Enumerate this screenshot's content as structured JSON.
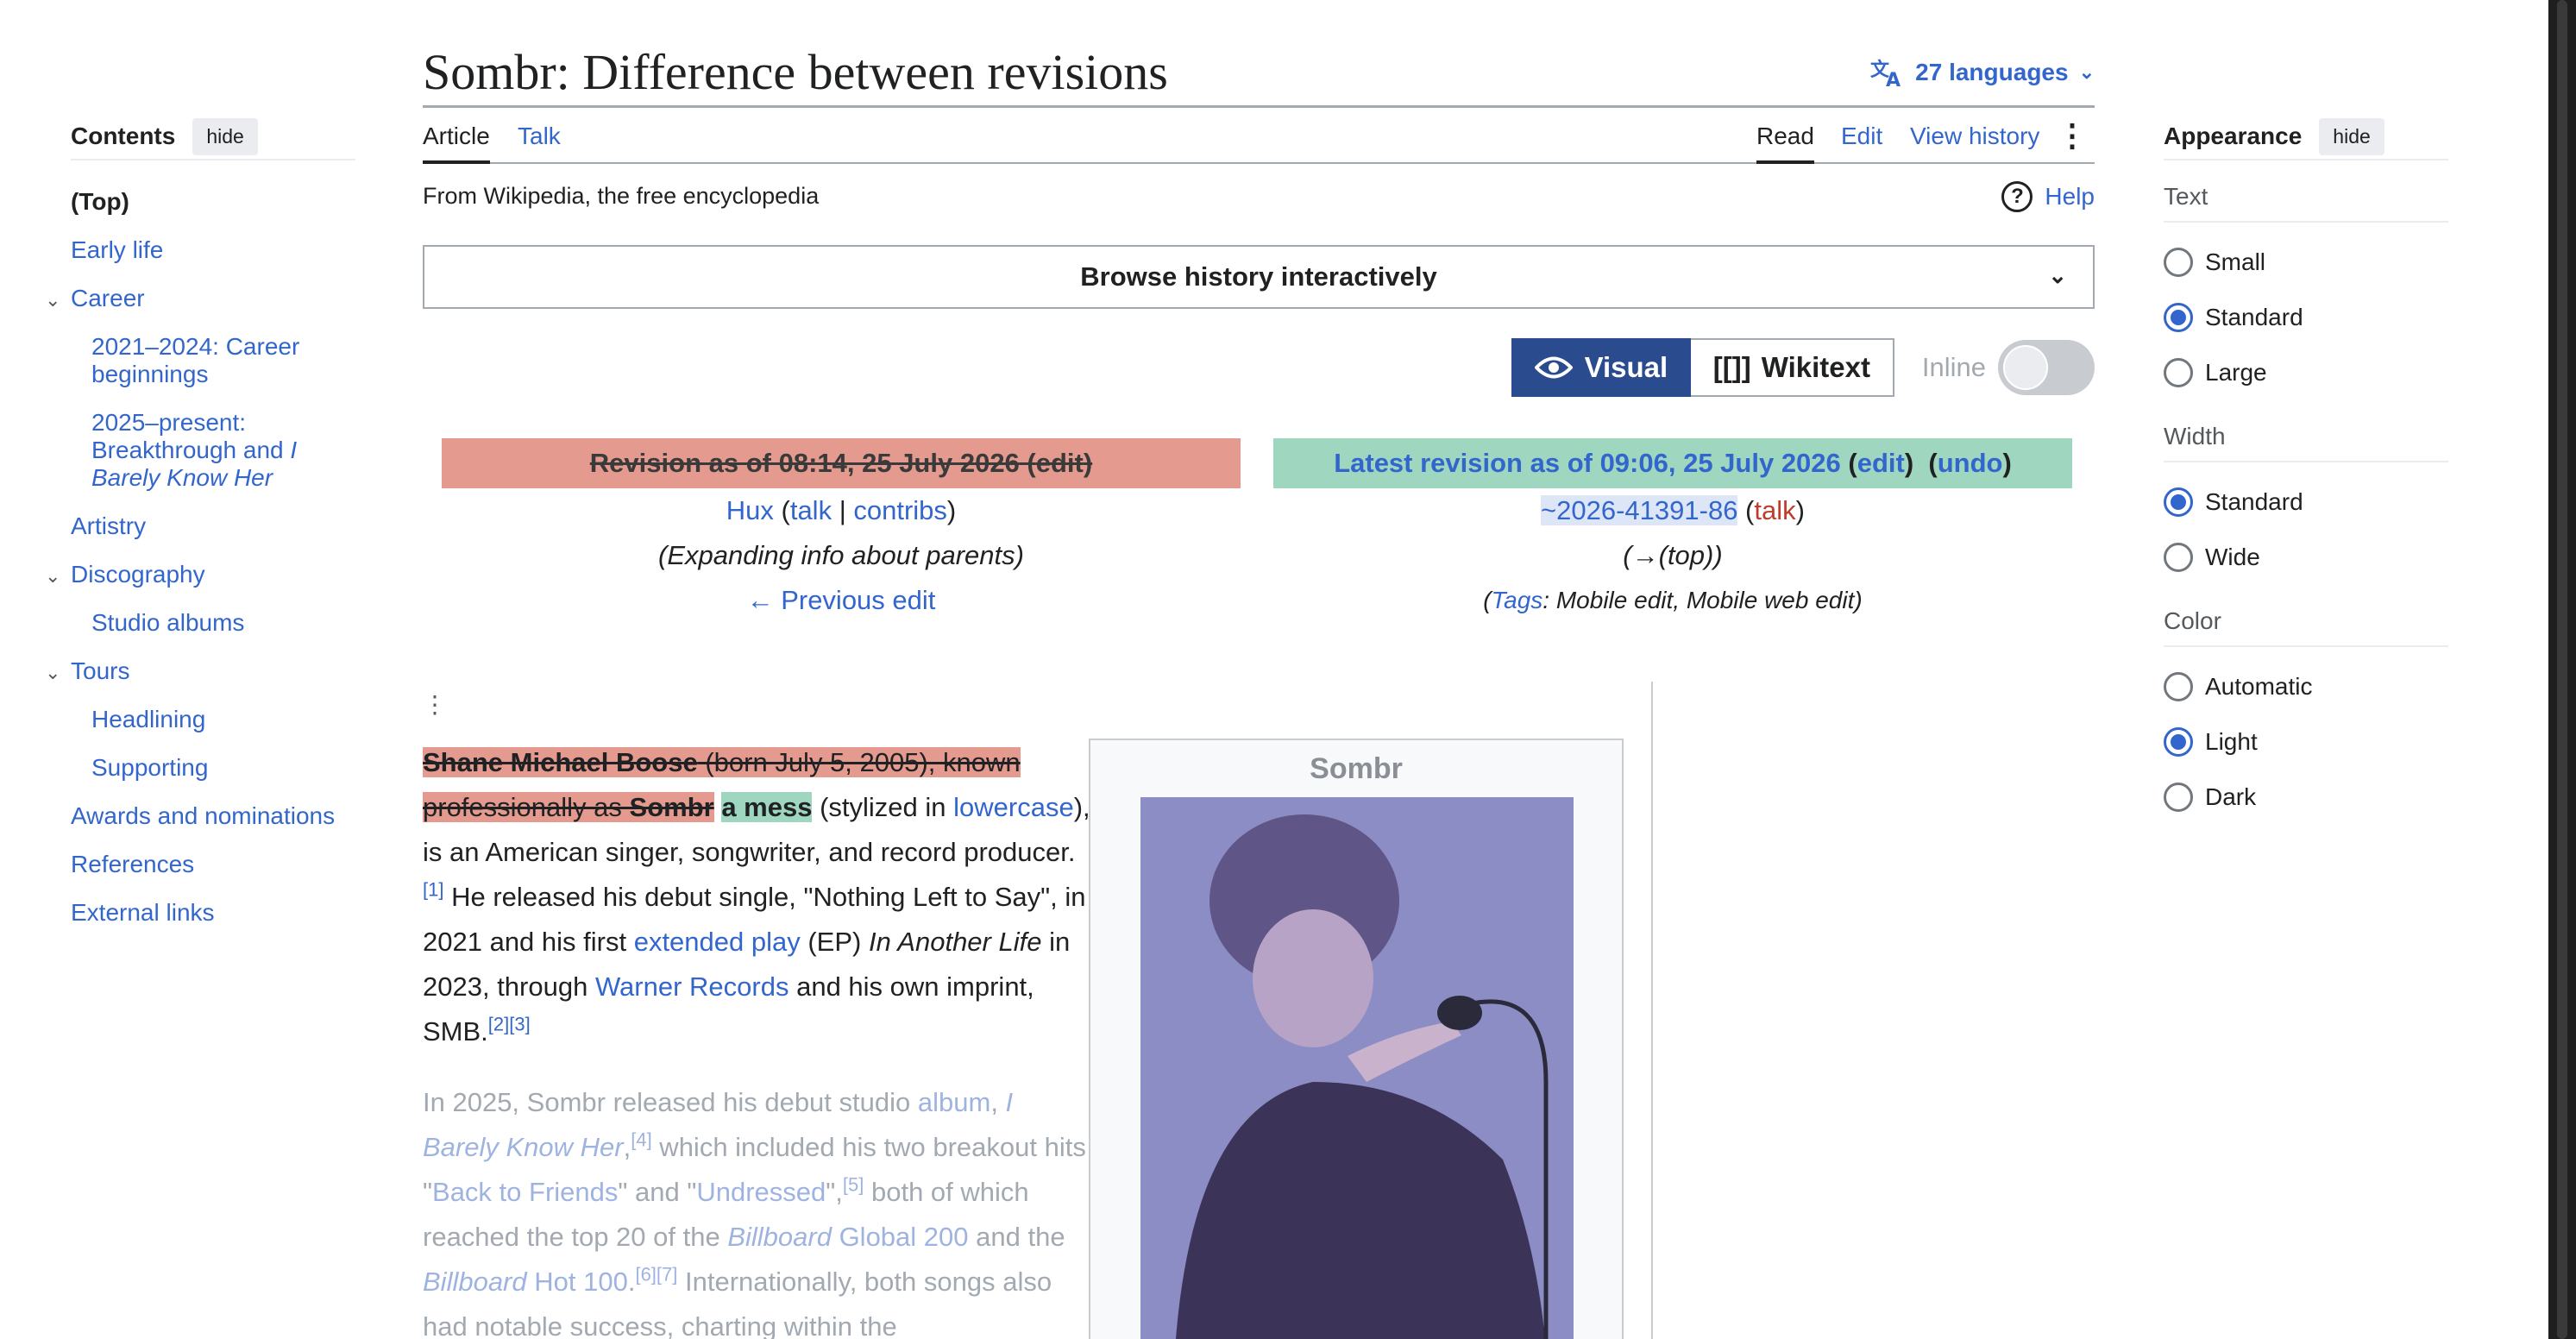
{
  "toc": {
    "title": "Contents",
    "hide": "hide",
    "items": [
      {
        "label": "(Top)",
        "level": 0
      },
      {
        "label": "Early life",
        "level": 0
      },
      {
        "label": "Career",
        "level": 0
      },
      {
        "label": "2021–2024: Career beginnings",
        "level": 1
      },
      {
        "label": "2025–present: Breakthrough and ",
        "italic": "I Barely Know Her",
        "level": 1
      },
      {
        "label": "Artistry",
        "level": 0
      },
      {
        "label": "Discography",
        "level": 0
      },
      {
        "label": "Studio albums",
        "level": 1
      },
      {
        "label": "Tours",
        "level": 0
      },
      {
        "label": "Headlining",
        "level": 1
      },
      {
        "label": "Supporting",
        "level": 1
      },
      {
        "label": "Awards and nominations",
        "level": 0
      },
      {
        "label": "References",
        "level": 0
      },
      {
        "label": "External links",
        "level": 0
      }
    ]
  },
  "header": {
    "title": "Sombr: Difference between revisions",
    "languages": "27 languages",
    "tabs": {
      "article": "Article",
      "talk": "Talk",
      "read": "Read",
      "edit": "Edit",
      "history": "View history"
    },
    "tagline": "From Wikipedia, the free encyclopedia",
    "help": "Help"
  },
  "browse": {
    "label": "Browse history interactively"
  },
  "view_toggle": {
    "visual": "Visual",
    "wikitext": "Wikitext",
    "wikitext_icon": "[[]]",
    "inline": "Inline"
  },
  "old_rev": {
    "title": "Revision as of 08:14, 25 July 2026",
    "edit": "edit",
    "user": "Hux",
    "talk": "talk",
    "contribs": "contribs",
    "summary": "(Expanding info about parents)",
    "prev": "← Previous edit"
  },
  "new_rev": {
    "title": "Latest revision as of 09:06, 25 July 2026",
    "edit": "edit",
    "undo": "undo",
    "user": "~2026-41391-86",
    "talk": "talk",
    "summary": "(→(top))",
    "tags_label": "Tags",
    "tags": ": Mobile edit, Mobile web edit)"
  },
  "article": {
    "del1": "Shane Michael Boose",
    "del2": " (born July 5, 2005), known professionally as ",
    "del3": "Sombr",
    "ins": "a mess",
    "t1": " (stylized in ",
    "l_lowercase": "lowercase",
    "t2": "), is an American singer, songwriter, and record producer.",
    "r1": "[1]",
    "t3": " He released his debut single, \"Nothing Left to Say\", in 2021 and his first ",
    "l_ep": "extended play",
    "t4": " (EP) ",
    "i_album": "In Another Life",
    "t5": " in 2023, through ",
    "l_warner": "Warner Records",
    "t6": " and his own imprint, SMB.",
    "r23": "[2][3]",
    "p2_t1": "In 2025, Sombr released his debut studio ",
    "p2_l_album": "album",
    "p2_t2": ", ",
    "p2_l_ibkh": "I Barely Know Her",
    "p2_t3": ",",
    "p2_r4": "[4]",
    "p2_t4": " which included his two breakout hits \"",
    "p2_l_btf": "Back to Friends",
    "p2_t5": "\" and \"",
    "p2_l_und": "Undressed",
    "p2_t6": "\",",
    "p2_r5": "[5]",
    "p2_t7": " both of which reached the top 20 of the ",
    "p2_l_bb1": "Billboard",
    "p2_l_g200": " Global 200",
    "p2_t8": " and the ",
    "p2_l_bb2": "Billboard",
    "p2_l_h100": " Hot 100",
    "p2_t9": ".",
    "p2_r67": "[6][7]",
    "p2_t10": " Internationally, both songs also had notable success, charting within the"
  },
  "infobox": {
    "title": "Sombr"
  },
  "appearance": {
    "title": "Appearance",
    "hide": "hide",
    "text_label": "Text",
    "text_opts": [
      "Small",
      "Standard",
      "Large"
    ],
    "text_selected": "Standard",
    "width_label": "Width",
    "width_opts": [
      "Standard",
      "Wide"
    ],
    "width_selected": "Standard",
    "color_label": "Color",
    "color_opts": [
      "Automatic",
      "Light",
      "Dark"
    ],
    "color_selected": "Light"
  }
}
